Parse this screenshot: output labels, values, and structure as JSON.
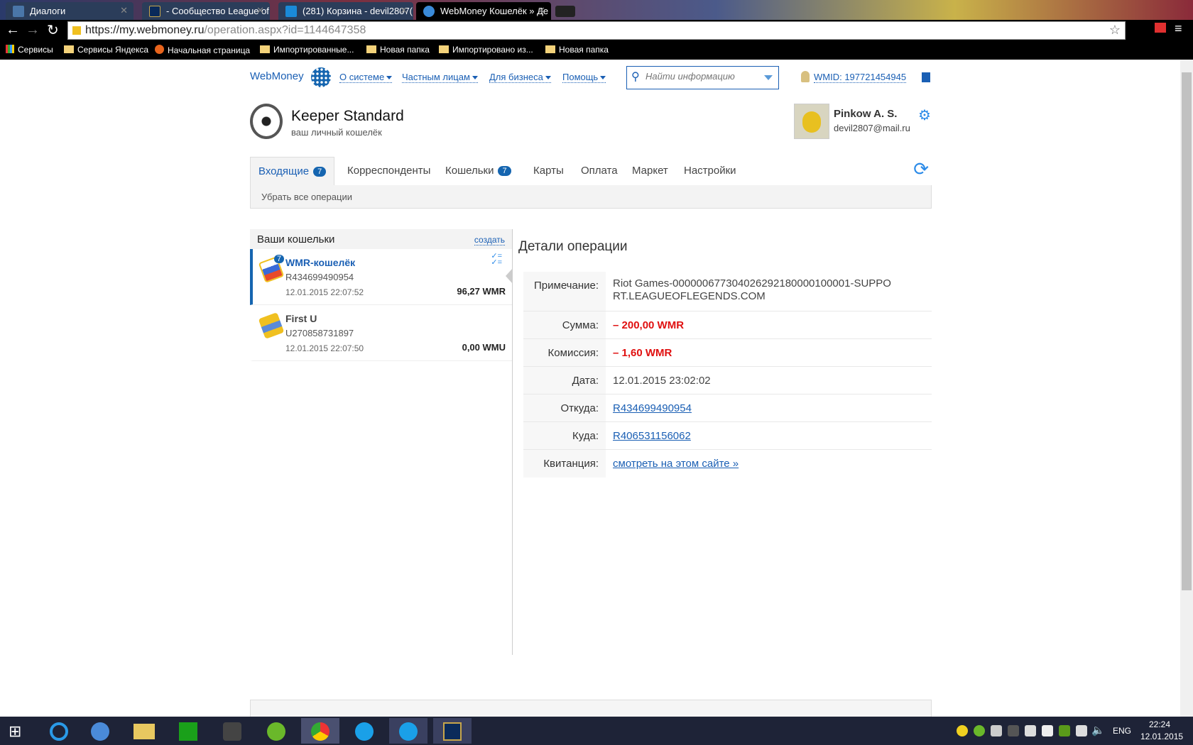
{
  "browser": {
    "tabs": [
      {
        "title": "Диалоги"
      },
      {
        "title": "- Сообщество League of"
      },
      {
        "title": "(281) Корзина - devil2807("
      },
      {
        "title": "WebMoney Кошелёк » Де"
      }
    ],
    "url_host": "https://my.webmoney.ru",
    "url_path": "/operation.aspx?id=1144647358",
    "bookmarks": [
      "Сервисы",
      "Сервисы Яндекса",
      "Начальная страница",
      "Импортированные...",
      "Новая папка",
      "Импортировано из...",
      "Новая папка"
    ]
  },
  "header": {
    "logo": "WebMoney",
    "nav": [
      "О системе",
      "Частным лицам",
      "Для бизнеса",
      "Помощь"
    ],
    "search_placeholder": "Найти информацию",
    "wmid": "WMID: 197721454945"
  },
  "keeper": {
    "title": "Keeper Standard",
    "subtitle": "ваш личный кошелёк",
    "user_name": "Pinkow A. S.",
    "user_email": "devil2807@mail.ru"
  },
  "tabs": [
    {
      "label": "Входящие",
      "badge": "7"
    },
    {
      "label": "Корреспонденты"
    },
    {
      "label": "Кошельки",
      "badge": "7"
    },
    {
      "label": "Карты"
    },
    {
      "label": "Оплата"
    },
    {
      "label": "Маркет"
    },
    {
      "label": "Настройки"
    }
  ],
  "sub_action": "Убрать все операции",
  "wallets": {
    "title": "Ваши кошельки",
    "create": "создать",
    "items": [
      {
        "name": "WMR-кошелёк",
        "badge": "7",
        "number": "R434699490954",
        "date": "12.01.2015 22:07:52",
        "balance": "96,27 WMR"
      },
      {
        "name": "First U",
        "number": "U270858731897",
        "date": "12.01.2015 22:07:50",
        "balance": "0,00 WMU"
      }
    ]
  },
  "details": {
    "title": "Детали операции",
    "rows": [
      {
        "label": "Примечание:",
        "value": "Riot Games-000000677304026292180000100001-SUPPORT.LEAGUEOFLEGENDS.COM"
      },
      {
        "label": "Сумма:",
        "value": "– 200,00 WMR"
      },
      {
        "label": "Комиссия:",
        "value": "– 1,60 WMR"
      },
      {
        "label": "Дата:",
        "value": "12.01.2015 23:02:02"
      },
      {
        "label": "Откуда:",
        "value": "R434699490954"
      },
      {
        "label": "Куда:",
        "value": "R406531156062"
      },
      {
        "label": "Квитанция:",
        "value": "смотреть на этом сайте »"
      }
    ]
  },
  "taskbar": {
    "lang": "ENG",
    "time": "22:24",
    "date": "12.01.2015"
  }
}
